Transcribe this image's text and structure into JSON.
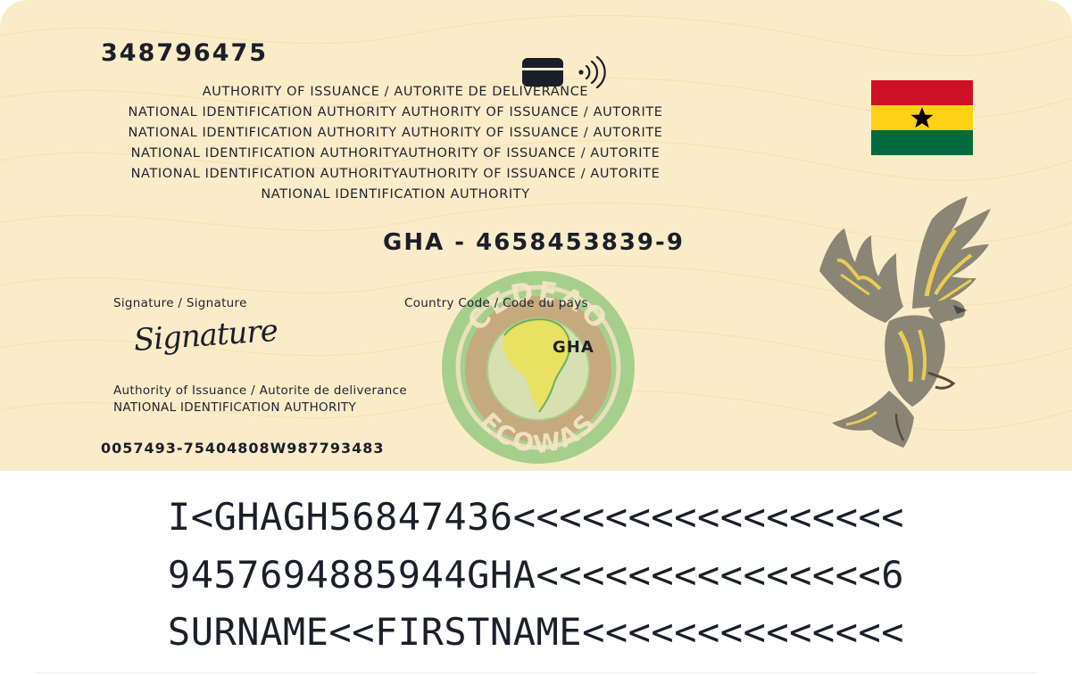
{
  "card": {
    "number": "348796475",
    "authority_lines": [
      "AUTHORITY OF ISSUANCE / AUTORITE DE DELIVERANCE",
      "NATIONAL IDENTIFICATION AUTHORITY AUTHORITY OF ISSUANCE / AUTORITE",
      "NATIONAL IDENTIFICATION AUTHORITY AUTHORITY OF ISSUANCE / AUTORITE",
      "NATIONAL IDENTIFICATION AUTHORITYAUTHORITY OF ISSUANCE / AUTORITE",
      "NATIONAL IDENTIFICATION AUTHORITYAUTHORITY OF ISSUANCE / AUTORITE",
      "NATIONAL IDENTIFICATION AUTHORITY"
    ],
    "id_number": "GHA - 4658453839-9",
    "signature_label": "Signature / Signature",
    "signature_text": "Signature",
    "country_code_label": "Country Code / Code du pays",
    "country_code": "GHA",
    "authority_small": [
      "Authority of Issuance / Autorite de deliverance",
      "NATIONAL IDENTIFICATION AUTHORITY"
    ],
    "bottom_code": "0057493-75404808W987793483",
    "seal": {
      "top_text": "CEDEAO",
      "bottom_text": "ECOWAS"
    },
    "icons": [
      "chip-icon",
      "contactless-icon",
      "ghana-flag",
      "ecowas-seal",
      "eagle-emblem"
    ]
  },
  "mrz": [
    "I<GHAGH56847436<<<<<<<<<<<<<<<<<",
    "9457694885944GHA<<<<<<<<<<<<<<<6",
    "SURNAME<<FIRSTNAME<<<<<<<<<<<<<<"
  ],
  "colors": {
    "card_background": "#fbecc9",
    "text": "#1b1f2a",
    "flag_red": "#ce1126",
    "flag_gold": "#fcd116",
    "flag_green": "#006b3f",
    "flag_star": "#000000",
    "seal_green": "#8fc67b",
    "seal_tan": "#c9a57c",
    "eagle_gray": "#8a8574",
    "eagle_gold": "#e8cc55"
  }
}
